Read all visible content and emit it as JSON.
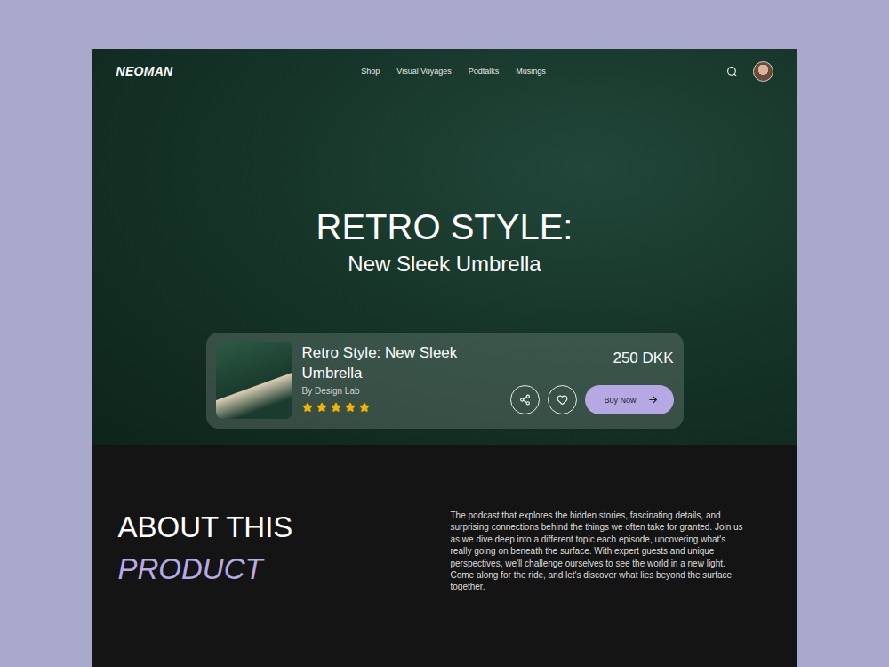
{
  "nav": {
    "logo": "NEOMAN",
    "links": [
      {
        "label": "Shop"
      },
      {
        "label": "Visual Voyages"
      },
      {
        "label": "Podtalks"
      },
      {
        "label": "Musings"
      }
    ]
  },
  "hero": {
    "title": "RETRO STYLE:",
    "subtitle": "New Sleek Umbrella"
  },
  "product_card": {
    "title": "Retro Style: New Sleek Umbrella",
    "author": "By Design Lab",
    "stars": 5,
    "stars_max": 5,
    "price": "250 DKK",
    "buy_button": "Buy Now"
  },
  "about": {
    "heading": "ABOUT THIS",
    "heading_accent": "PRODUCT",
    "description": "The podcast that explores the hidden stories, fascinating details, and surprising connections behind the things we often take for granted. Join us as we dive deep into a different topic each episode, uncovering what's really going on beneath the surface. With expert guests and unique perspectives, we'll challenge ourselves to see the world in a new light. Come along for the ride, and let's discover what lies beyond the surface together."
  }
}
